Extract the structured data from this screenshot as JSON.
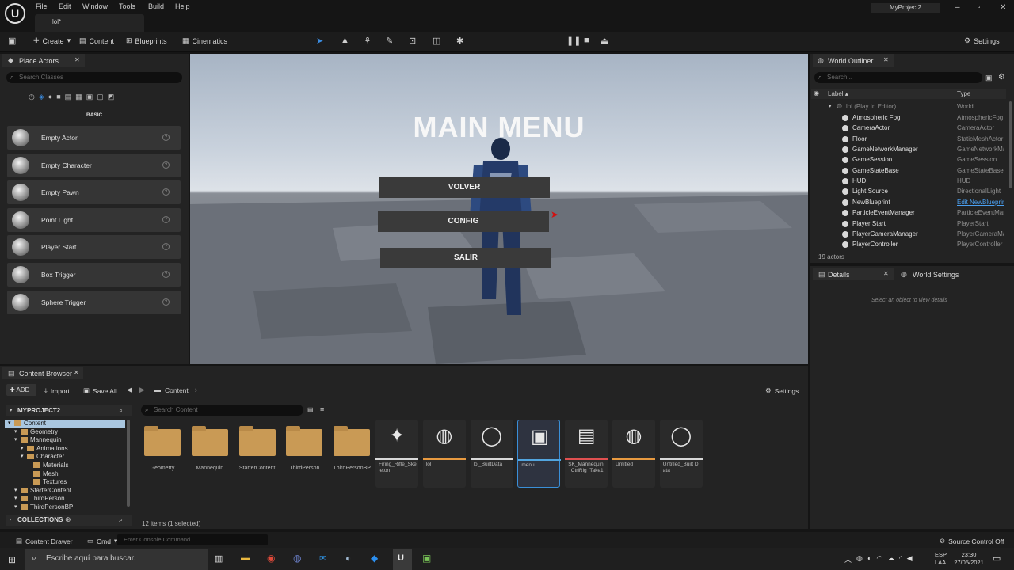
{
  "menubar": {
    "items": [
      "File",
      "Edit",
      "Window",
      "Tools",
      "Build",
      "Help"
    ],
    "doc_tab": "lol*",
    "project": "MyProject2",
    "win_controls": [
      "–",
      "▫",
      "✕"
    ]
  },
  "toolbar": {
    "create": "Create",
    "content": "Content",
    "blueprints": "Blueprints",
    "cinematics": "Cinematics",
    "settings": "Settings"
  },
  "place_actors": {
    "tab": "Place Actors",
    "search_placeholder": "Search Classes",
    "section": "BASIC",
    "items": [
      "Empty Actor",
      "Empty Character",
      "Empty Pawn",
      "Point Light",
      "Player Start",
      "Box Trigger",
      "Sphere Trigger"
    ]
  },
  "viewport": {
    "title": "MAIN MENU",
    "buttons": [
      "VOLVER",
      "CONFIG",
      "SALIR"
    ]
  },
  "outliner": {
    "tab": "World Outliner",
    "search_placeholder": "Search...",
    "col_label": "Label ▴",
    "col_type": "Type",
    "root": {
      "name": "lol (Play In Editor)",
      "type": "World"
    },
    "rows": [
      {
        "name": "Atmospheric Fog",
        "type": "AtmosphericFog"
      },
      {
        "name": "CameraActor",
        "type": "CameraActor"
      },
      {
        "name": "Floor",
        "type": "StaticMeshActor"
      },
      {
        "name": "GameNetworkManager",
        "type": "GameNetworkManager"
      },
      {
        "name": "GameSession",
        "type": "GameSession"
      },
      {
        "name": "GameStateBase",
        "type": "GameStateBase"
      },
      {
        "name": "HUD",
        "type": "HUD"
      },
      {
        "name": "Light Source",
        "type": "DirectionalLight"
      },
      {
        "name": "NewBlueprint",
        "type": "Edit NewBlueprint"
      },
      {
        "name": "ParticleEventManager",
        "type": "ParticleEventManager"
      },
      {
        "name": "Player Start",
        "type": "PlayerStart"
      },
      {
        "name": "PlayerCameraManager",
        "type": "PlayerCameraManager"
      },
      {
        "name": "PlayerController",
        "type": "PlayerController"
      }
    ],
    "count": "19 actors"
  },
  "details": {
    "tab": "Details",
    "tab2": "World Settings",
    "empty": "Select an object to view details"
  },
  "content_browser": {
    "tab": "Content Browser",
    "add": "ADD",
    "import": "Import",
    "save_all": "Save All",
    "breadcrumb": "Content",
    "settings": "Settings",
    "project": "MYPROJECT2",
    "search_placeholder": "Search Content",
    "tree": [
      {
        "label": "Content",
        "depth": 0
      },
      {
        "label": "Geometry",
        "depth": 1
      },
      {
        "label": "Mannequin",
        "depth": 1
      },
      {
        "label": "Animations",
        "depth": 2
      },
      {
        "label": "Character",
        "depth": 2
      },
      {
        "label": "Materials",
        "depth": 3
      },
      {
        "label": "Mesh",
        "depth": 3
      },
      {
        "label": "Textures",
        "depth": 3
      },
      {
        "label": "StarterContent",
        "depth": 1
      },
      {
        "label": "ThirdPerson",
        "depth": 1
      },
      {
        "label": "ThirdPersonBP",
        "depth": 1
      }
    ],
    "collections": "COLLECTIONS",
    "folders": [
      "Geometry",
      "Mannequin",
      "StarterContent",
      "ThirdPerson",
      "ThirdPersonBP"
    ],
    "assets": [
      "Firing_Rifle_Skeleton",
      "lol",
      "lol_BuiltData",
      "menu",
      "SK_Mannequin_CtrlRig_Take1",
      "Untitled",
      "Untitled_Built Data"
    ],
    "status": "12 items (1 selected)"
  },
  "bottombar": {
    "drawer": "Content Drawer",
    "cmd": "Cmd",
    "console_placeholder": "Enter Console Command",
    "source_control": "Source Control Off"
  },
  "taskbar": {
    "search": "Escribe aquí para buscar.",
    "lang": "ESP",
    "lang2": "LAA",
    "time": "23:30",
    "date": "27/05/2021"
  }
}
